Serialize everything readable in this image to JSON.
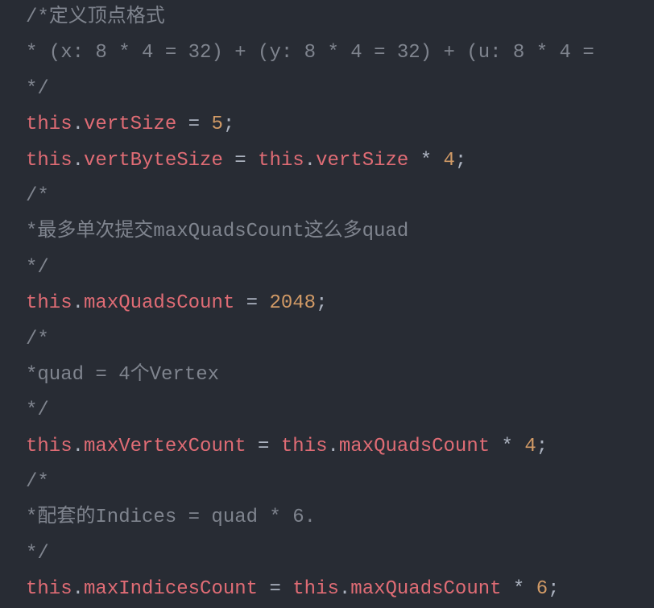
{
  "lines": {
    "comment1_1": "/*定义顶点格式",
    "comment1_2": "* (x: 8 * 4 = 32) + (y: 8 * 4 = 32) + (u: 8 * 4 =",
    "comment1_3": "*/",
    "kw_this": "this",
    "dot": ".",
    "prop_vertSize": "vertSize",
    "eq": " = ",
    "num_5": "5",
    "semi": ";",
    "prop_vertByteSize": "vertByteSize",
    "star": " * ",
    "num_4": "4",
    "comment2_1": "/*",
    "comment2_2": "*最多单次提交maxQuadsCount这么多quad",
    "comment2_3": "*/",
    "prop_maxQuadsCount": "maxQuadsCount",
    "num_2048": "2048",
    "comment3_1": "/*",
    "comment3_2": "*quad = 4个Vertex",
    "comment3_3": "*/",
    "prop_maxVertexCount": "maxVertexCount",
    "comment4_1": "/*",
    "comment4_2": "*配套的Indices = quad * 6.",
    "comment4_3": "*/",
    "prop_maxIndicesCount": "maxIndicesCount",
    "num_6": "6"
  }
}
